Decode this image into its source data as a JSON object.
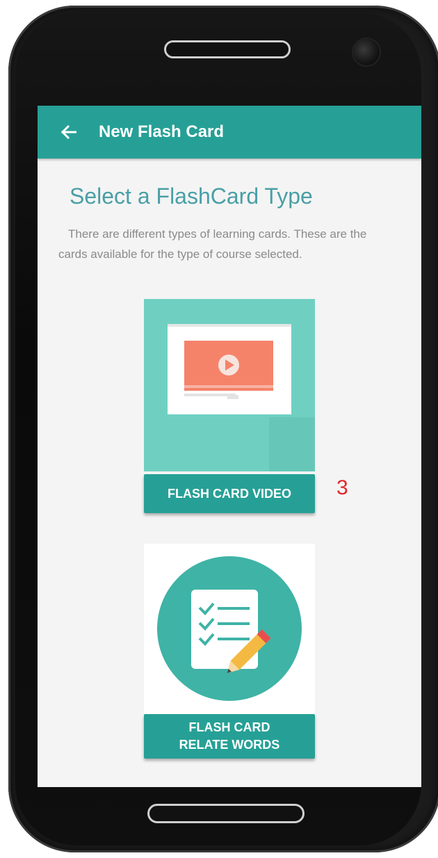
{
  "app_bar": {
    "title": "New Flash Card",
    "back_icon": "arrow-left-icon"
  },
  "page": {
    "heading": "Select a FlashCard Type",
    "description": "There are different types of learning cards. These are the cards available for the type of course selected."
  },
  "cards": [
    {
      "label": "FLASH CARD VIDEO",
      "image_icon": "video-player-icon"
    },
    {
      "label_line1": "FLASH CARD",
      "label_line2": "RELATE WORDS",
      "image_icon": "checklist-pencil-icon"
    }
  ],
  "annotation": "3",
  "colors": {
    "accent": "#26a096",
    "heading": "#4a9fa6",
    "video_bg": "#6fd0c2",
    "video_player": "#f5836a",
    "annotation": "#e3262a"
  }
}
